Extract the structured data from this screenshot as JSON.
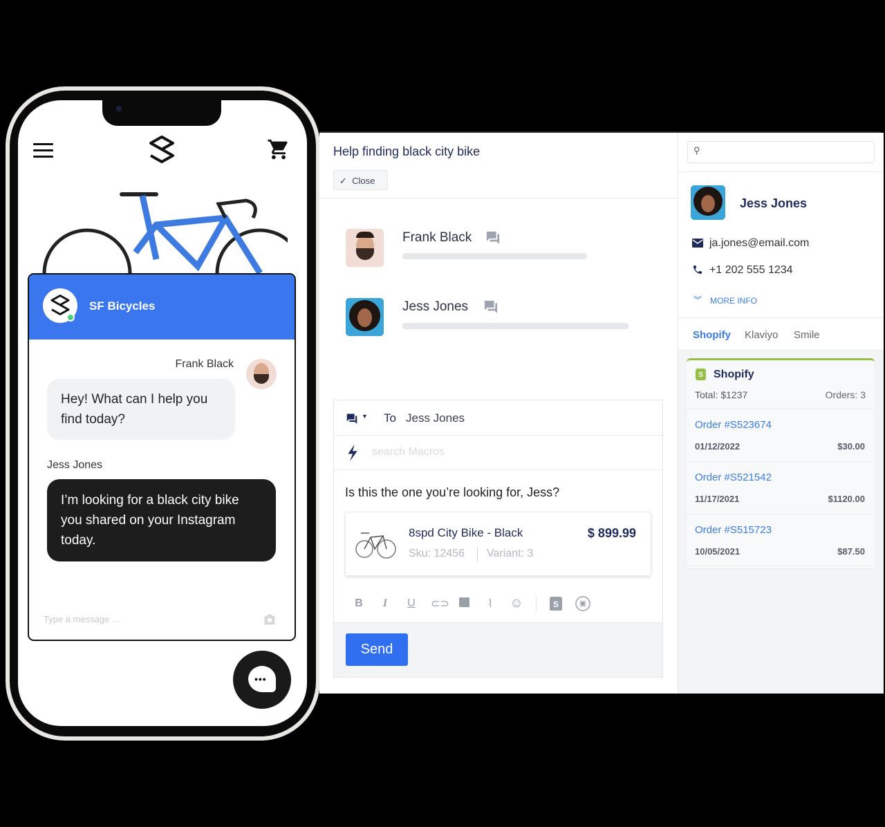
{
  "phone": {
    "store_name": "SF Bicycles",
    "messages": [
      {
        "author": "Frank Black",
        "text": "Hey! What can I help you find today?"
      },
      {
        "author": "Jess Jones",
        "text": "I’m looking for a black city bike you shared on your Instagram today."
      }
    ],
    "input_placeholder": "Type a message ...",
    "colors": {
      "header": "#3a76ee",
      "online": "#4cd07d"
    }
  },
  "ticket": {
    "title": "Help finding black city bike",
    "close_label": "Close",
    "participants": [
      {
        "name": "Frank Black"
      },
      {
        "name": "Jess Jones"
      }
    ],
    "composer": {
      "to_label": "To",
      "to_value": "Jess Jones",
      "macros_placeholder": "search Macros",
      "body": "Is this the one you’re looking for, Jess?",
      "product": {
        "name": "8spd City Bike - Black",
        "price": "$ 899.99",
        "sku": "Sku: 12456",
        "variant": "Variant: 3"
      },
      "toolbar": [
        "bold",
        "italic",
        "underline",
        "link",
        "image",
        "attach",
        "emoji",
        "shopify",
        "product"
      ],
      "send_label": "Send"
    }
  },
  "customer": {
    "search_placeholder": "",
    "name": "Jess Jones",
    "email": "ja.jones@email.com",
    "phone": "+1 202 555 1234",
    "more_info": "MORE INFO",
    "tabs": [
      "Shopify",
      "Klaviyo",
      "Smile"
    ],
    "shopify": {
      "title": "Shopify",
      "total": "Total: $1237",
      "orders_count": "Orders: 3",
      "orders": [
        {
          "id": "Order #S523674",
          "date": "01/12/2022",
          "amount": "$30.00"
        },
        {
          "id": "Order #S521542",
          "date": "11/17/2021",
          "amount": "$1120.00"
        },
        {
          "id": "Order #S515723",
          "date": "10/05/2021",
          "amount": "$87.50"
        }
      ]
    }
  }
}
